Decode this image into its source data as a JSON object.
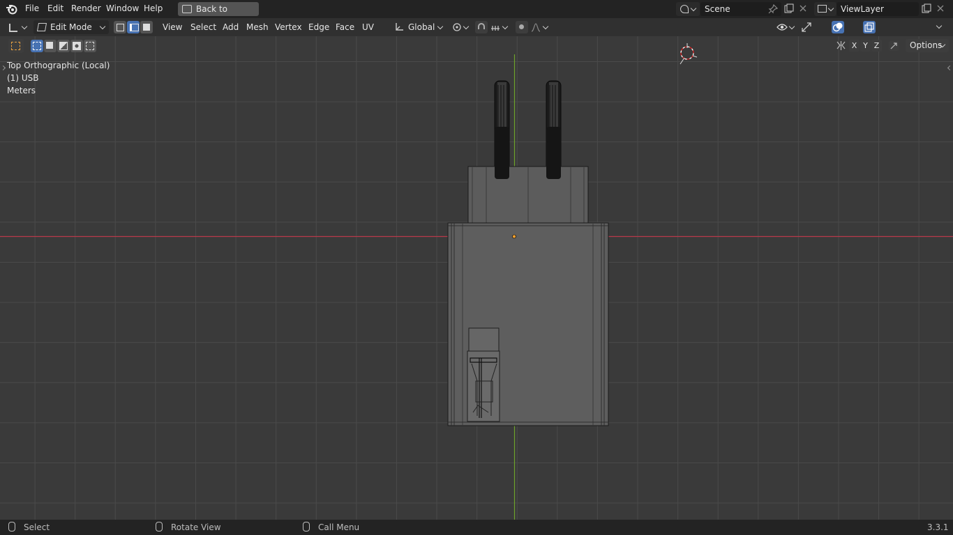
{
  "menubar": {
    "items": [
      "File",
      "Edit",
      "Render",
      "Window",
      "Help"
    ],
    "back_button": "Back to Previous",
    "scene_name": "Scene",
    "view_layer": "ViewLayer"
  },
  "header": {
    "mode": "Edit Mode",
    "menus": [
      "View",
      "Select",
      "Add",
      "Mesh",
      "Vertex",
      "Edge",
      "Face",
      "UV"
    ],
    "orientation": "Global",
    "options_label": "Options",
    "axes": [
      "X",
      "Y",
      "Z"
    ]
  },
  "viewport": {
    "view_name": "Top Orthographic (Local)",
    "object_name": "(1) USB",
    "units": "Meters"
  },
  "statusbar": {
    "select": "Select",
    "rotate": "Rotate View",
    "menu": "Call Menu",
    "version": "3.3.1"
  },
  "colors": {
    "x_axis": "#b8394a",
    "y_axis": "#6ea32c",
    "active_button": "#4772b3"
  }
}
